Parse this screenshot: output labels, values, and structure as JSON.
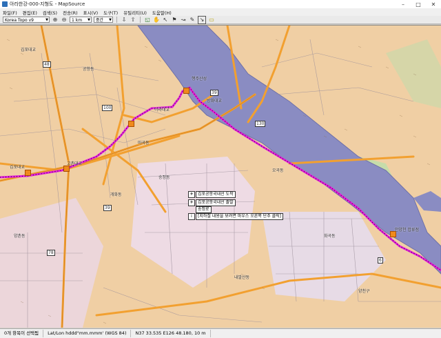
{
  "window": {
    "title": "아라한강-000-지형도 - MapSource",
    "min": "–",
    "max": "□",
    "close": "✕"
  },
  "menu": [
    "파일(F)",
    "편집(E)",
    "검색(S)",
    "전송(R)",
    "표시(V)",
    "도구(T)",
    "유틸리티(U)",
    "도움말(H)"
  ],
  "toolbar": {
    "map_product": "Korea Topo v9",
    "scale": "1 km",
    "detail": "중간"
  },
  "map": {
    "place_labels": [
      "김포대교",
      "일산대교",
      "행주대교",
      "행주산성",
      "방화대교",
      "방화동",
      "개화동",
      "공항동",
      "오곡동",
      "마곡동",
      "송정동",
      "내발산동",
      "화곡동",
      "신월동",
      "목동",
      "강서구",
      "양천구",
      "가양동",
      "등촌동",
      "염창동",
      "고촌읍",
      "김포",
      "양촌동",
      "계양동",
      "부천시",
      "원당동",
      "신평동",
      "과해동",
      "고강동",
      "영등포동",
      "안양천 합류점"
    ],
    "waypoints": [
      "방화대교",
      "행주산성",
      "안양천 합류점",
      "김포대교",
      "고촌대교",
      "아라대교"
    ],
    "road_shields": [
      "48",
      "39",
      "100",
      "130",
      "6",
      "78",
      "39"
    ],
    "route_color": "#e020d8",
    "popup_lines": [
      "김포공항국내선 도착",
      "김포공항국내선 출발",
      "송정로",
      "[지하철 내용을 보려면 마우스 오른쪽 단추 클릭]"
    ]
  },
  "status": {
    "selection": "0개 항목이 선택됨",
    "format": "Lat/Lon hddd°mm.mmm' (WGS 84)",
    "coords": "N37 33.535 E126 48.180, 10 m"
  },
  "colors": {
    "land": "#f0cfa4",
    "river": "#8a8cc2",
    "route": "#e020d8",
    "highway": "#f2a030",
    "urban": "#e4d7e6",
    "park": "#c6dcaa"
  }
}
